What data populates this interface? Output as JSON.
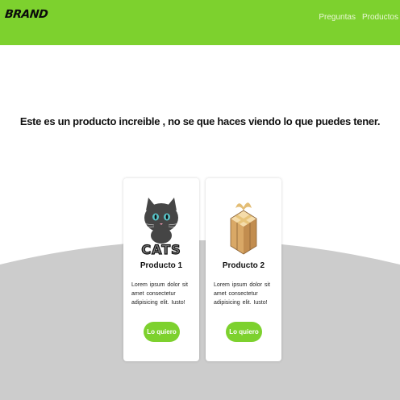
{
  "header": {
    "brand": "BRAND",
    "nav": [
      {
        "label": "Preguntas"
      },
      {
        "label": "Productos"
      }
    ]
  },
  "hero": {
    "text": "Este es un producto increible , no se que haces viendo lo que puedes tener."
  },
  "products": [
    {
      "title": "Producto 1",
      "description": "Lorem ipsum dolor sit amet consectetur adipisicing elit. Iusto!",
      "image": "cats-logo-icon",
      "image_text": "CATS",
      "button": "Lo quiero"
    },
    {
      "title": "Producto 2",
      "description": "Lorem ipsum dolor sit amet consectetur adipisicing elit. Iusto!",
      "image": "gift-box-icon",
      "button": "Lo quiero"
    }
  ],
  "colors": {
    "accent": "#7dd12e",
    "wave": "#cccccc",
    "text": "#111111"
  }
}
